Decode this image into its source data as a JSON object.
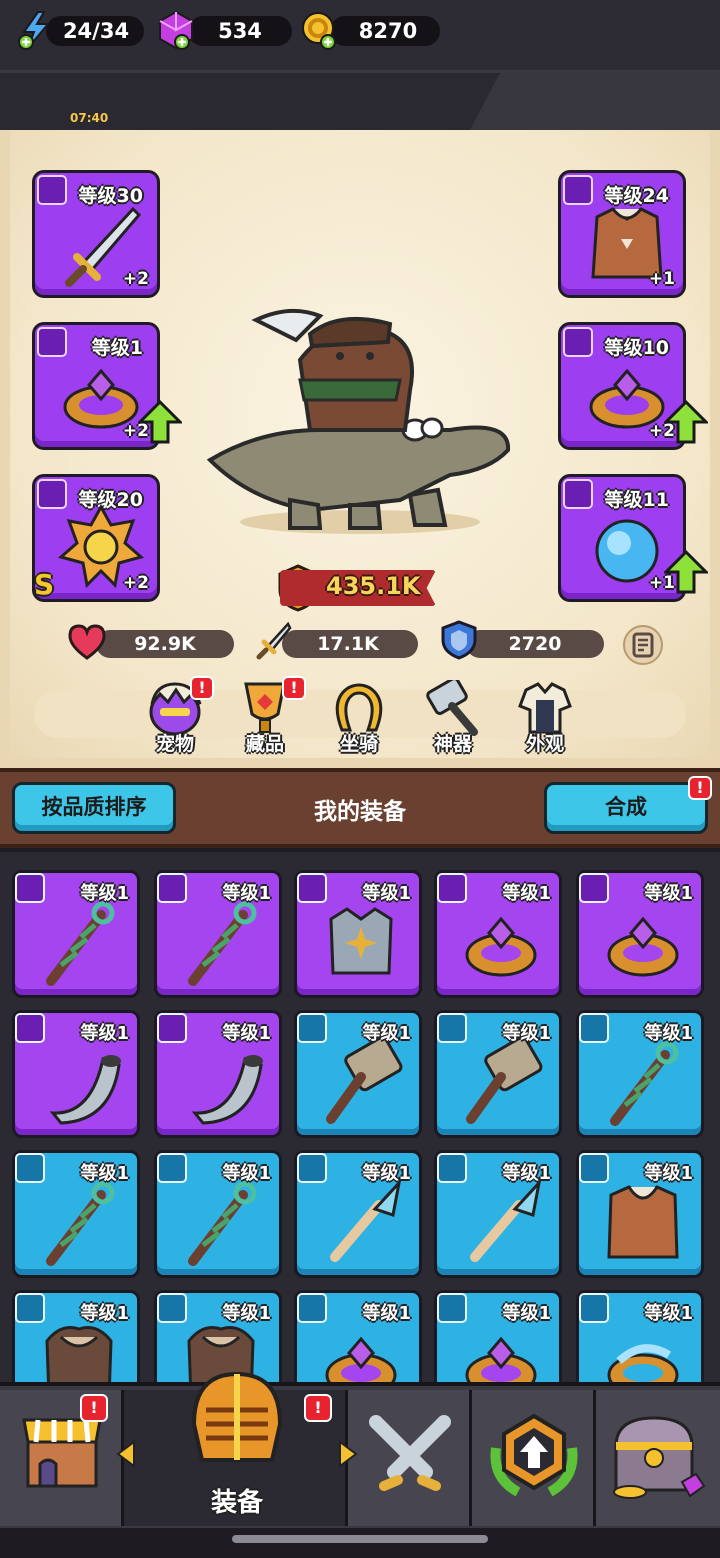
{
  "resources": {
    "energy": "24/34",
    "energy_timer": "07:40",
    "gems": "534",
    "coins": "8270"
  },
  "equipped": {
    "weapon": {
      "level": "等级30",
      "plus": "+2",
      "icon": "sword-icon"
    },
    "armor": {
      "level": "等级24",
      "plus": "+1",
      "icon": "armor-icon"
    },
    "ring_left": {
      "level": "等级1",
      "plus": "+2",
      "icon": "ring-icon"
    },
    "ring_right": {
      "level": "等级10",
      "plus": "+2",
      "icon": "ring-icon"
    },
    "necklace": {
      "level": "等级20",
      "plus": "+2",
      "rank": "S",
      "icon": "amulet-icon"
    },
    "orb": {
      "level": "等级11",
      "plus": "+1",
      "icon": "orb-icon"
    }
  },
  "hero": {
    "power": "435.1K",
    "hp": "92.9K",
    "attack": "17.1K",
    "defense": "2720"
  },
  "menu": [
    "宠物",
    "藏品",
    "坐骑",
    "神器",
    "外观"
  ],
  "section": {
    "sort_button": "按品质排序",
    "title": "我的装备",
    "merge_button": "合成"
  },
  "inventory": [
    {
      "level": "等级1",
      "rarity": "purple",
      "item": "staff"
    },
    {
      "level": "等级1",
      "rarity": "purple",
      "item": "staff"
    },
    {
      "level": "等级1",
      "rarity": "purple",
      "item": "armor"
    },
    {
      "level": "等级1",
      "rarity": "purple",
      "item": "ring"
    },
    {
      "level": "等级1",
      "rarity": "purple",
      "item": "ring"
    },
    {
      "level": "等级1",
      "rarity": "purple",
      "item": "horn"
    },
    {
      "level": "等级1",
      "rarity": "purple",
      "item": "horn"
    },
    {
      "level": "等级1",
      "rarity": "blue",
      "item": "hammer"
    },
    {
      "level": "等级1",
      "rarity": "blue",
      "item": "hammer"
    },
    {
      "level": "等级1",
      "rarity": "blue",
      "item": "staff"
    },
    {
      "level": "等级1",
      "rarity": "blue",
      "item": "staff"
    },
    {
      "level": "等级1",
      "rarity": "blue",
      "item": "staff"
    },
    {
      "level": "等级1",
      "rarity": "blue",
      "item": "spear"
    },
    {
      "level": "等级1",
      "rarity": "blue",
      "item": "spear"
    },
    {
      "level": "等级1",
      "rarity": "blue",
      "item": "vest"
    },
    {
      "level": "等级1",
      "rarity": "blue",
      "item": "fur"
    },
    {
      "level": "等级1",
      "rarity": "blue",
      "item": "fur"
    },
    {
      "level": "等级1",
      "rarity": "blue",
      "item": "ring"
    },
    {
      "level": "等级1",
      "rarity": "blue",
      "item": "ring"
    },
    {
      "level": "等级1",
      "rarity": "blue",
      "item": "ring2"
    }
  ],
  "nav": {
    "active_label": "装备",
    "tabs": [
      "shop-icon",
      "helmet-icon",
      "crossed-swords-icon",
      "upgrade-icon",
      "chest-icon"
    ]
  },
  "colors": {
    "purple": "#a445f0",
    "blue": "#2eb2e4",
    "accent_cyan": "#3ec6e8",
    "badge_red": "#e7232f"
  }
}
